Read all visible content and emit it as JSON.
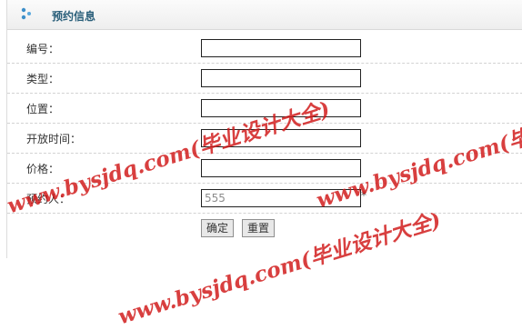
{
  "header": {
    "title": "预约信息",
    "icon": "blue-dots-icon"
  },
  "form": {
    "fields": [
      {
        "label": "编号：",
        "value": ""
      },
      {
        "label": "类型：",
        "value": ""
      },
      {
        "label": "位置：",
        "value": ""
      },
      {
        "label": "开放时间：",
        "value": ""
      },
      {
        "label": "价格：",
        "value": ""
      },
      {
        "label": "预约人：",
        "value": "555",
        "required_mark": "*"
      }
    ],
    "confirm_label": "确定",
    "reset_label": "重置"
  },
  "watermark": {
    "text": "www.bysjdq.com(毕业设计大全)",
    "color": "#d01515"
  }
}
